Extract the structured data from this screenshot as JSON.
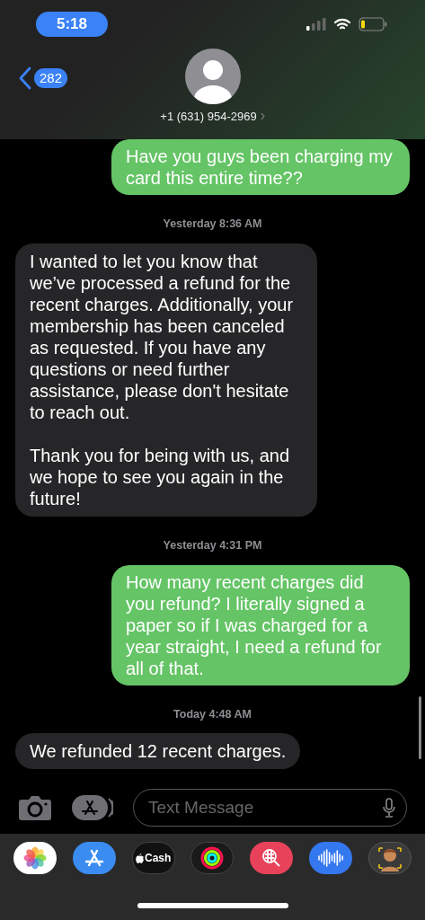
{
  "status_bar": {
    "time": "5:18"
  },
  "header": {
    "back_count": "282",
    "contact": "+1 (631) 954-2969"
  },
  "messages": [
    {
      "kind": "outgoing",
      "text": "Have you guys been charging my card this entire time??"
    },
    {
      "kind": "timestamp",
      "text": "Yesterday 8:36 AM"
    },
    {
      "kind": "incoming",
      "text": "I wanted to let you know that we’ve processed a refund for the recent charges. Additionally, your membership has been canceled as requested. If you have any questions or need further assistance, please don't hesitate to reach out.\n\nThank you for being with us, and we hope to see you again in the future!"
    },
    {
      "kind": "timestamp",
      "text": "Yesterday 4:31 PM"
    },
    {
      "kind": "outgoing",
      "text": "How many recent charges did you refund? I literally signed a paper so if I was charged for a year straight, I need a refund for all of that."
    },
    {
      "kind": "timestamp",
      "text": "Today 4:48 AM"
    },
    {
      "kind": "incoming",
      "text": "We refunded 12 recent charges."
    }
  ],
  "composer": {
    "placeholder": "Text Message"
  },
  "app_tray": [
    {
      "kind": "photos"
    },
    {
      "kind": "appstore"
    },
    {
      "kind": "cash",
      "label": "Cash"
    },
    {
      "kind": "activity"
    },
    {
      "kind": "images"
    },
    {
      "kind": "audio"
    },
    {
      "kind": "memoji"
    }
  ]
}
